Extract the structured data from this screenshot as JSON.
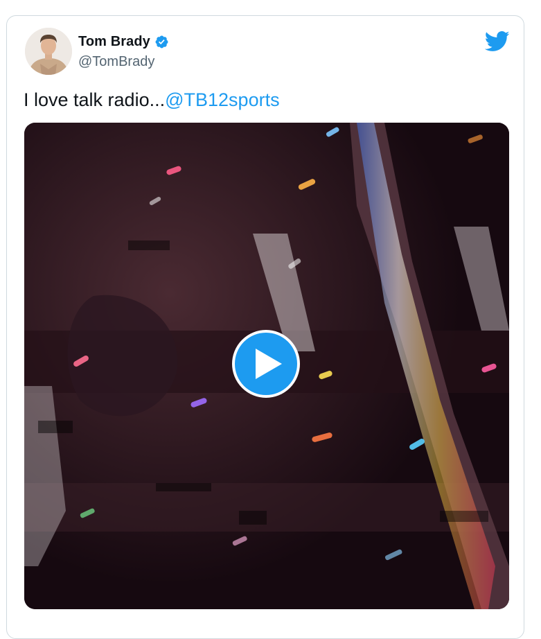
{
  "tweet": {
    "author": {
      "display_name": "Tom Brady",
      "handle": "@TomBrady",
      "verified": true,
      "avatar_icon": "profile-photo"
    },
    "text": "I love talk radio...",
    "mention": "@TB12sports",
    "media": {
      "type": "video",
      "play_icon": "play-icon"
    },
    "brand_icon": "twitter-bird-icon"
  },
  "colors": {
    "accent": "#1d9bf0",
    "text_primary": "#0f1419",
    "text_secondary": "#536471",
    "border": "#cfd9de"
  }
}
